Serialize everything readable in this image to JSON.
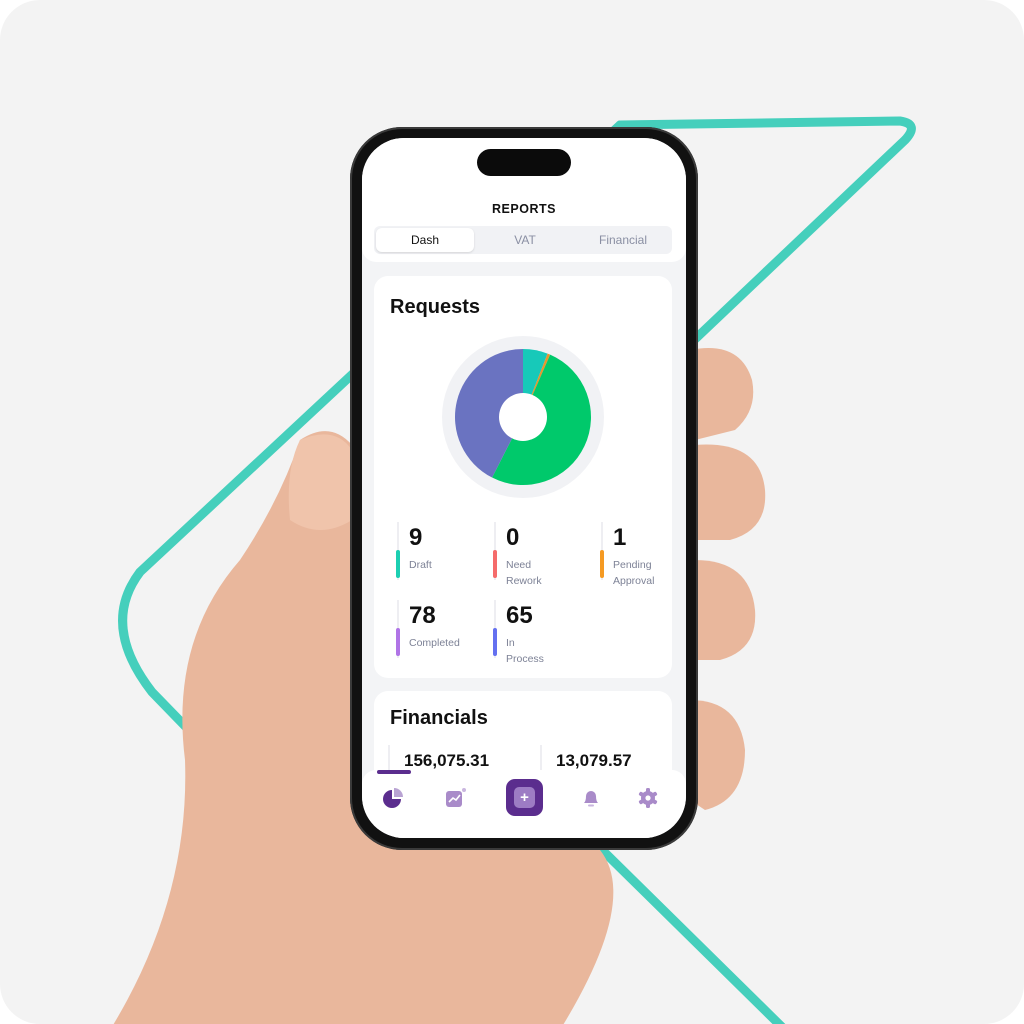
{
  "header": {
    "title": "REPORTS"
  },
  "tabs": [
    {
      "label": "Dash",
      "active": true
    },
    {
      "label": "VAT",
      "active": false
    },
    {
      "label": "Financial",
      "active": false
    }
  ],
  "requests": {
    "title": "Requests",
    "stats": [
      {
        "value": "9",
        "label": "Draft",
        "color": "#1ccfb2"
      },
      {
        "value": "0",
        "label": "Need Rework",
        "color": "#f56b6b"
      },
      {
        "value": "1",
        "label": "Pending Approval",
        "color": "#f59a23"
      },
      {
        "value": "78",
        "label": "Completed",
        "color": "#b074e6"
      },
      {
        "value": "65",
        "label": "In Process",
        "color": "#6470f0"
      }
    ],
    "pie": [
      {
        "label": "Draft",
        "value": 9,
        "color": "#17c9b9"
      },
      {
        "label": "Need Rework",
        "value": 0,
        "color": "#f56b6b"
      },
      {
        "label": "Pending Approval",
        "value": 1,
        "color": "#e8962c"
      },
      {
        "label": "Completed",
        "value": 78,
        "color": "#00c96b"
      },
      {
        "label": "In Process",
        "value": 65,
        "color": "#6a73c1"
      }
    ]
  },
  "financials": {
    "title": "Financials",
    "values": [
      "156,075.31",
      "13,079.57"
    ]
  },
  "nav": {
    "items": [
      "pie-chart-icon",
      "trend-chart-icon",
      "add-icon",
      "bell-icon",
      "gear-icon"
    ],
    "active": 0,
    "accent": "#5b2d8e"
  }
}
